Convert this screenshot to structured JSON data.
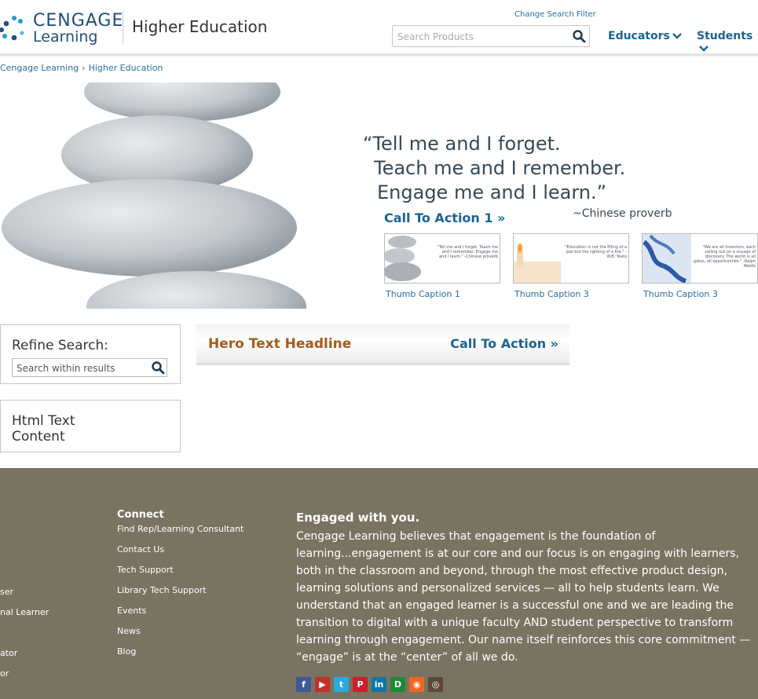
{
  "header": {
    "logo_line1": "CENGAGE",
    "logo_line2": "Learning",
    "site_title": "Higher Education",
    "change_filter": "Change Search Filter",
    "search_placeholder": "Search Products",
    "nav": [
      "Educators",
      "Students"
    ]
  },
  "breadcrumb": [
    "Cengage Learning",
    "Higher Education"
  ],
  "hero": {
    "quote_lines": [
      "“Tell me and I forget.",
      "Teach me and I remember.",
      "Engage me and I learn.”"
    ],
    "quote_source": "~Chinese proverb",
    "cta": "Call To Action 1",
    "thumbs": [
      {
        "caption": "Thumb Caption 1",
        "text": "\"Tell me and I forget. Teach me and I remember. Engage me and I learn.\" -Chinese proverb"
      },
      {
        "caption": "Thumb Caption 3",
        "text": "\"Education is not the filling of a pail but the lighting of a fire.\" -W.B. Yeats"
      },
      {
        "caption": "Thumb Caption 3",
        "text": "\"We are all inventors, each sailing out on a voyage of discovery. The world is all gates, all opportunities.\" -Ralph Waldo"
      }
    ]
  },
  "refine": {
    "title": "Refine Search:",
    "placeholder": "Search within results"
  },
  "html_text": "Html Text Content",
  "hero_bar": {
    "headline": "Hero Text Headline",
    "cta": "Call To Action"
  },
  "footer": {
    "left_links": [
      "ser",
      "nal Learner",
      "ator",
      "or"
    ],
    "connect_heading": "Connect",
    "connect_links": [
      "Find Rep/Learning Consultant",
      "Contact Us",
      "Tech Support",
      "Library Tech Support",
      "Events",
      "News",
      "Blog"
    ],
    "engaged_heading": "Engaged with you.",
    "engaged_text": "Cengage Learning believes that engagement is the foundation of learning...engagement is at our core and our focus is on engaging with learners, both in the classroom and beyond, through the most effective product design, learning solutions and personalized services — all to help students learn. We understand that an engaged learner is a successful one and we are leading the transition to digital with a unique faculty AND student perspective to transform learning through engagement. Our name itself reinforces this core commitment — “engage” is at the “center” of all we do.",
    "social": [
      {
        "name": "facebook-icon",
        "glyph": "f",
        "color": "#3b5998"
      },
      {
        "name": "youtube-icon",
        "glyph": "▶",
        "color": "#c4302b"
      },
      {
        "name": "twitter-icon",
        "glyph": "t",
        "color": "#2aa9e0"
      },
      {
        "name": "pinterest-icon",
        "glyph": "P",
        "color": "#cb2027"
      },
      {
        "name": "linkedin-icon",
        "glyph": "in",
        "color": "#0e76a8"
      },
      {
        "name": "blog-icon",
        "glyph": "D",
        "color": "#1b8a3a"
      },
      {
        "name": "rss-icon",
        "glyph": "◉",
        "color": "#f26522"
      },
      {
        "name": "instagram-icon",
        "glyph": "◎",
        "color": "#5b4a3a"
      }
    ]
  }
}
